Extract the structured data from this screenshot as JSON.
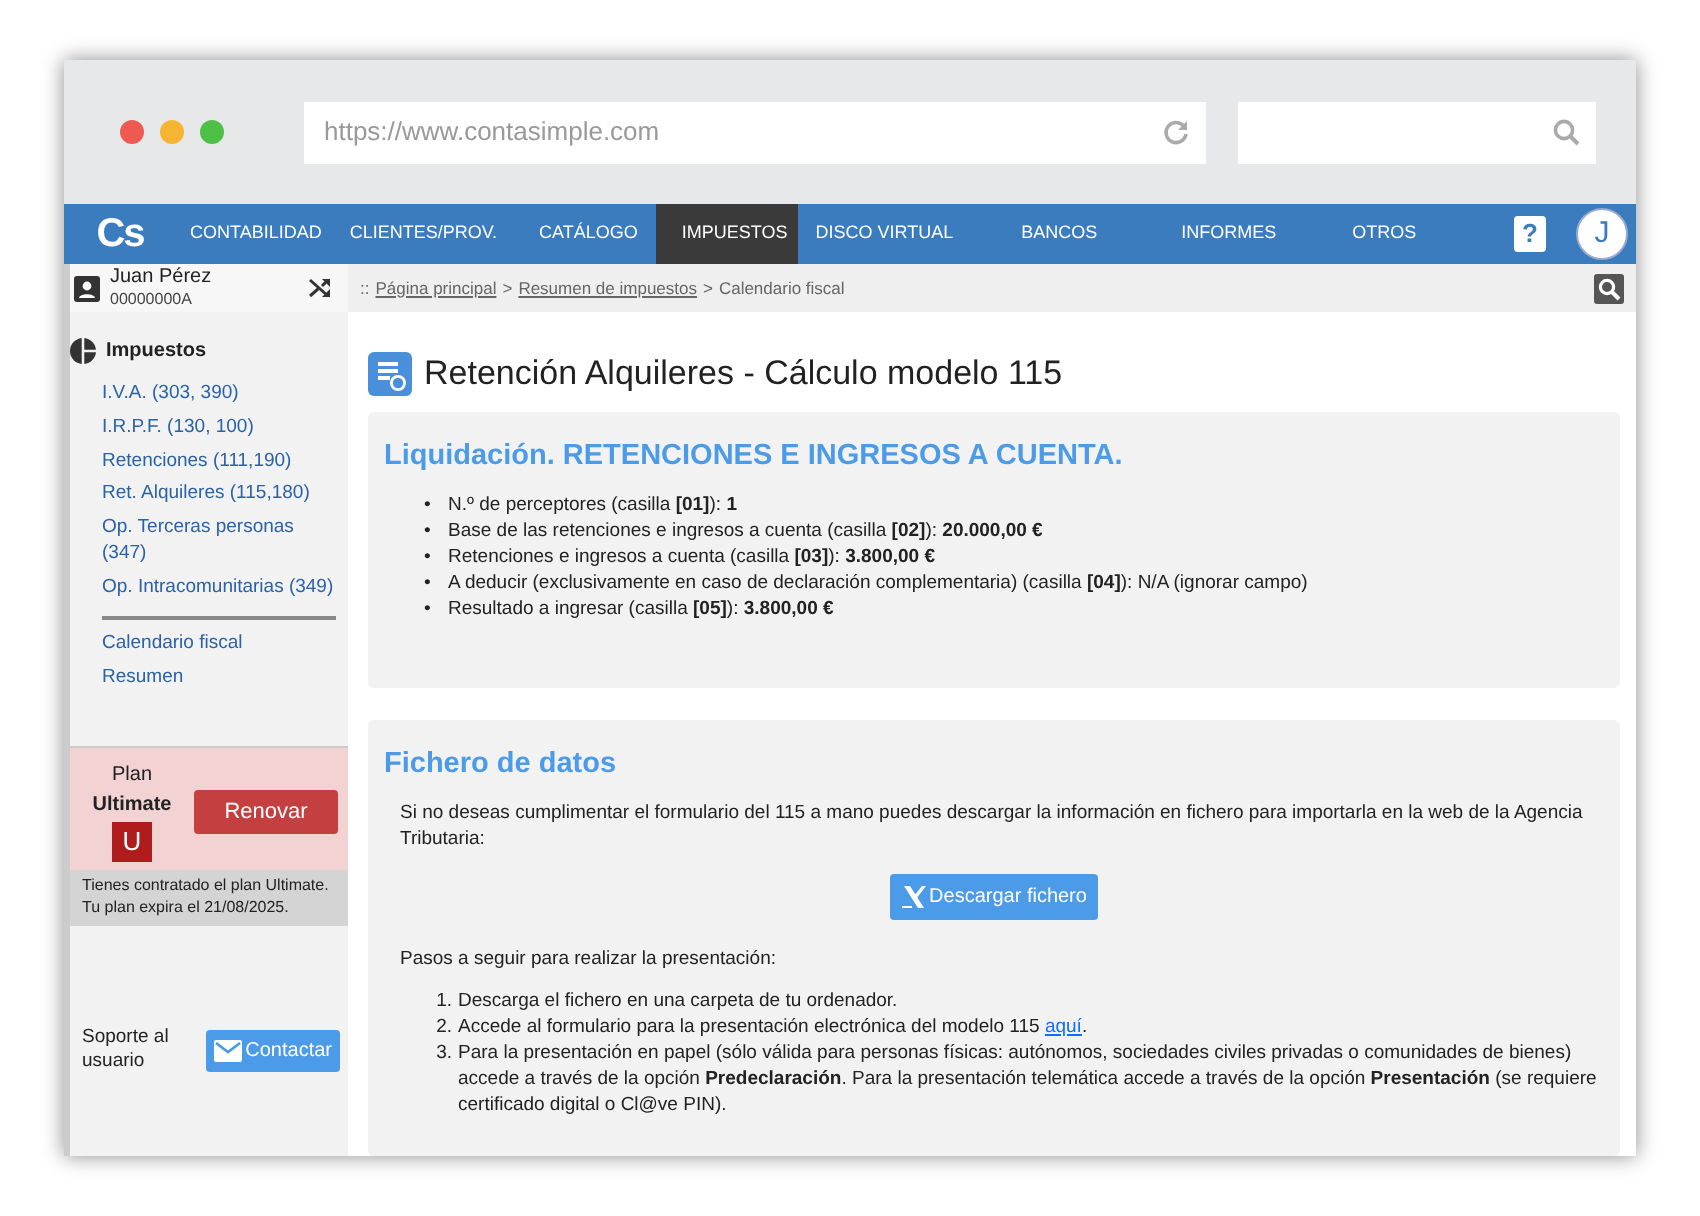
{
  "browser": {
    "url": "https://www.contasimple.com"
  },
  "nav": {
    "logo": "Cs",
    "items": [
      {
        "label": "CONTABILIDAD",
        "selected": false
      },
      {
        "label": "CLIENTES/PROV.",
        "selected": false
      },
      {
        "label": "CATÁLOGO",
        "selected": false
      },
      {
        "label": "IMPUESTOS",
        "selected": true
      },
      {
        "label": "DISCO VIRTUAL",
        "selected": false
      },
      {
        "label": "BANCOS",
        "selected": false
      },
      {
        "label": "INFORMES",
        "selected": false
      },
      {
        "label": "OTROS",
        "selected": false
      }
    ],
    "help": "?",
    "avatar": "J"
  },
  "user": {
    "name": "Juan Pérez",
    "id": "00000000A"
  },
  "breadcrumb": [
    {
      "kind": "prefix",
      "text": "::"
    },
    {
      "kind": "link",
      "text": "Página principal"
    },
    {
      "kind": "separator",
      "text": ">"
    },
    {
      "kind": "link",
      "text": "Resumen de impuestos"
    },
    {
      "kind": "separator",
      "text": ">"
    },
    {
      "kind": "current",
      "text": "Calendario fiscal"
    }
  ],
  "sidebar": {
    "title": "Impuestos",
    "items": [
      {
        "label": "I.V.A. (303, 390)"
      },
      {
        "label": "I.R.P.F. (130, 100)"
      },
      {
        "label": "Retenciones (111,190)"
      },
      {
        "label": "Ret. Alquileres (115,180)"
      },
      {
        "label": "Op. Terceras personas (347)"
      },
      {
        "label": "Op. Intracomunitarias (349)"
      }
    ],
    "extra_items": [
      {
        "label": "Calendario fiscal"
      },
      {
        "label": "Resumen"
      }
    ]
  },
  "plan": {
    "label": "Plan",
    "name": "Ultimate",
    "badge": "U",
    "button": "Renovar",
    "note": "Tienes contratado el plan Ultimate. Tu plan expira el 21/08/2025."
  },
  "support": {
    "label": "Soporte al usuario",
    "button": "Contactar"
  },
  "main": {
    "title": "Retención Alquileres - Cálculo modelo 115",
    "liquidation": {
      "heading": "Liquidación. RETENCIONES E INGRESOS A CUENTA.",
      "items": [
        {
          "marker": "•",
          "text": "N.º de perceptores (casilla **[01]**): **1**"
        },
        {
          "marker": "•",
          "text": "Base de las retenciones e ingresos a cuenta (casilla **[02]**): **20.000,00 €**"
        },
        {
          "marker": "•",
          "text": "Retenciones e ingresos a cuenta (casilla **[03]**): **3.800,00 €**"
        },
        {
          "marker": "•",
          "text": "A deducir (exclusivamente en caso de declaración complementaria) (casilla **[04]**): N/A (ignorar campo)"
        },
        {
          "marker": "•",
          "text": "Resultado a ingresar (casilla **[05]**): **3.800,00 €**"
        }
      ]
    },
    "data_file": {
      "heading": "Fichero de datos",
      "intro": "Si no deseas cumplimentar el formulario del 115 a mano puedes descargar la información en fichero para importarla en la web de la Agencia Tributaria:",
      "button": "Descargar fichero",
      "steps_intro": "Pasos a seguir para realizar la presentación:",
      "steps": [
        {
          "marker": "1.",
          "text": "Descarga el fichero en una carpeta de tu ordenador."
        },
        {
          "marker": "2.",
          "text": "Accede al formulario para la presentación electrónica del modelo 115 ",
          "link": "aquí",
          "after": "."
        },
        {
          "marker": "3.",
          "text": "Para la presentación en papel (sólo válida para personas físicas: autónomos, sociedades civiles privadas o comunidades de bienes) accede a través de la opción **Predeclaración**. Para la presentación telemática accede a través de la opción **Presentación** (se requiere certificado digital o Cl@ve PIN)."
        }
      ]
    }
  }
}
